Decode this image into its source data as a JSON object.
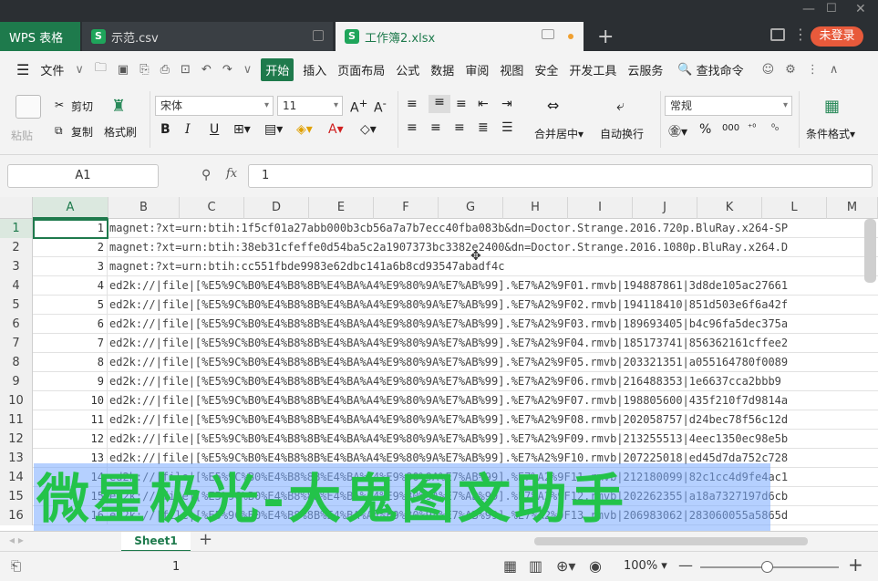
{
  "tabs": {
    "app": "WPS 表格",
    "file1": "示范.csv",
    "file2": "工作簿2.xlsx",
    "login": "未登录"
  },
  "menu": {
    "file": "文件",
    "items": [
      "开始",
      "插入",
      "页面布局",
      "公式",
      "数据",
      "审阅",
      "视图",
      "安全",
      "开发工具",
      "云服务"
    ],
    "search": "查找命令"
  },
  "ribbon": {
    "paste": "粘贴",
    "cut": "剪切",
    "copy": "复制",
    "format_painter": "格式刷",
    "font": "宋体",
    "size": "11",
    "bold": "B",
    "italic": "I",
    "underline": "U",
    "merge": "合并居中",
    "wrap": "自动换行",
    "numfmt": "常规",
    "percent": "%",
    "thousand": "000",
    "cond_format": "条件格式"
  },
  "formula": {
    "cell": "A1",
    "fx": "fx",
    "value": "1"
  },
  "columns": [
    "A",
    "B",
    "C",
    "D",
    "E",
    "F",
    "G",
    "H",
    "I",
    "J",
    "K",
    "L",
    "M"
  ],
  "rows": [
    {
      "n": "1",
      "a": "1",
      "b": "magnet:?xt=urn:btih:1f5cf01a27abb000b3cb56a7a7b7ecc40fba083b&dn=Doctor.Strange.2016.720p.BluRay.x264-SP"
    },
    {
      "n": "2",
      "a": "2",
      "b": "magnet:?xt=urn:btih:38eb31cfeffe0d54ba5c2a1907373bc3382e2400&dn=Doctor.Strange.2016.1080p.BluRay.x264.D"
    },
    {
      "n": "3",
      "a": "3",
      "b": "magnet:?xt=urn:btih:cc551fbde9983e62dbc141a6b8cd93547abadf4c"
    },
    {
      "n": "4",
      "a": "4",
      "b": "ed2k://|file|[%E5%9C%B0%E4%B8%8B%E4%BA%A4%E9%80%9A%E7%AB%99].%E7%A2%9F01.rmvb|194887861|3d8de105ac27661"
    },
    {
      "n": "5",
      "a": "5",
      "b": "ed2k://|file|[%E5%9C%B0%E4%B8%8B%E4%BA%A4%E9%80%9A%E7%AB%99].%E7%A2%9F02.rmvb|194118410|851d503e6f6a42f"
    },
    {
      "n": "6",
      "a": "6",
      "b": "ed2k://|file|[%E5%9C%B0%E4%B8%8B%E4%BA%A4%E9%80%9A%E7%AB%99].%E7%A2%9F03.rmvb|189693405|b4c96fa5dec375a"
    },
    {
      "n": "7",
      "a": "7",
      "b": "ed2k://|file|[%E5%9C%B0%E4%B8%8B%E4%BA%A4%E9%80%9A%E7%AB%99].%E7%A2%9F04.rmvb|185173741|856362161cffee2"
    },
    {
      "n": "8",
      "a": "8",
      "b": "ed2k://|file|[%E5%9C%B0%E4%B8%8B%E4%BA%A4%E9%80%9A%E7%AB%99].%E7%A2%9F05.rmvb|203321351|a055164780f0089"
    },
    {
      "n": "9",
      "a": "9",
      "b": "ed2k://|file|[%E5%9C%B0%E4%B8%8B%E4%BA%A4%E9%80%9A%E7%AB%99].%E7%A2%9F06.rmvb|216488353|1e6637cca2bbb9"
    },
    {
      "n": "10",
      "a": "10",
      "b": "ed2k://|file|[%E5%9C%B0%E4%B8%8B%E4%BA%A4%E9%80%9A%E7%AB%99].%E7%A2%9F07.rmvb|198805600|435f210f7d9814a"
    },
    {
      "n": "11",
      "a": "11",
      "b": "ed2k://|file|[%E5%9C%B0%E4%B8%8B%E4%BA%A4%E9%80%9A%E7%AB%99].%E7%A2%9F08.rmvb|202058757|d24bec78f56c12d"
    },
    {
      "n": "12",
      "a": "12",
      "b": "ed2k://|file|[%E5%9C%B0%E4%B8%8B%E4%BA%A4%E9%80%9A%E7%AB%99].%E7%A2%9F09.rmvb|213255513|4eec1350ec98e5b"
    },
    {
      "n": "13",
      "a": "13",
      "b": "ed2k://|file|[%E5%9C%B0%E4%B8%8B%E4%BA%A4%E9%80%9A%E7%AB%99].%E7%A2%9F10.rmvb|207225018|ed45d7da752c728"
    },
    {
      "n": "14",
      "a": "14",
      "b": "ed2k://|file|[%E5%9C%B0%E4%B8%8B%E4%BA%A4%E9%80%9A%E7%AB%99].%E7%A2%9F11.rmvb|212180099|82c1cc4d9fe4ac1"
    },
    {
      "n": "15",
      "a": "15",
      "b": "ed2k://|file|[%E5%9C%B0%E4%B8%8B%E4%BA%A4%E9%80%9A%E7%AB%99].%E7%A2%9F12.rmvb|202262355|a18a7327197d6cb"
    },
    {
      "n": "16",
      "a": "16",
      "b": "ed2k://|file|[%E5%9C%B0%E4%B8%8B%E4%BA%A4%E9%80%9A%E7%AB%99].%E7%A2%9F13.rmvb|206983062|283060055a5865d"
    }
  ],
  "watermark": "微星极光-大鬼图文助手",
  "sheet": {
    "name": "Sheet1",
    "add": "+"
  },
  "status": {
    "value": "1",
    "zoom": "100%",
    "minus": "—",
    "plus": "+"
  }
}
